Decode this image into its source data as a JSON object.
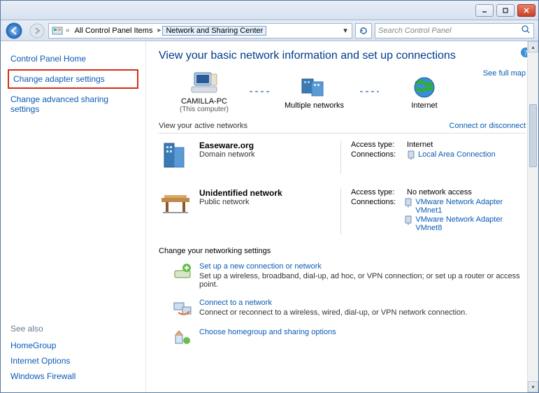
{
  "titlebar": {},
  "breadcrumb": {
    "prefix": "«",
    "item1": "All Control Panel Items",
    "item2": "Network and Sharing Center"
  },
  "search": {
    "placeholder": "Search Control Panel"
  },
  "sidebar": {
    "home": "Control Panel Home",
    "adapter": "Change adapter settings",
    "advanced": "Change advanced sharing settings",
    "seealso": "See also",
    "homegroup": "HomeGroup",
    "inetopts": "Internet Options",
    "firewall": "Windows Firewall"
  },
  "main": {
    "title": "View your basic network information and set up connections",
    "fullmap": "See full map",
    "topo": {
      "pc": "CAMILLA-PC",
      "pc_sub": "(This computer)",
      "multi": "Multiple networks",
      "internet": "Internet"
    },
    "active_head": "View your active networks",
    "connect_link": "Connect or disconnect",
    "labels": {
      "access": "Access type:",
      "connections": "Connections:"
    },
    "net1": {
      "name": "Easeware.org",
      "type": "Domain network",
      "access": "Internet",
      "conn1": "Local Area Connection"
    },
    "net2": {
      "name": "Unidentified network",
      "type": "Public network",
      "access": "No network access",
      "conn1": "VMware Network Adapter VMnet1",
      "conn2": "VMware Network Adapter VMnet8"
    },
    "settings_head": "Change your networking settings",
    "s1": {
      "title": "Set up a new connection or network",
      "desc": "Set up a wireless, broadband, dial-up, ad hoc, or VPN connection; or set up a router or access point."
    },
    "s2": {
      "title": "Connect to a network",
      "desc": "Connect or reconnect to a wireless, wired, dial-up, or VPN network connection."
    },
    "s3": {
      "title": "Choose homegroup and sharing options"
    }
  }
}
